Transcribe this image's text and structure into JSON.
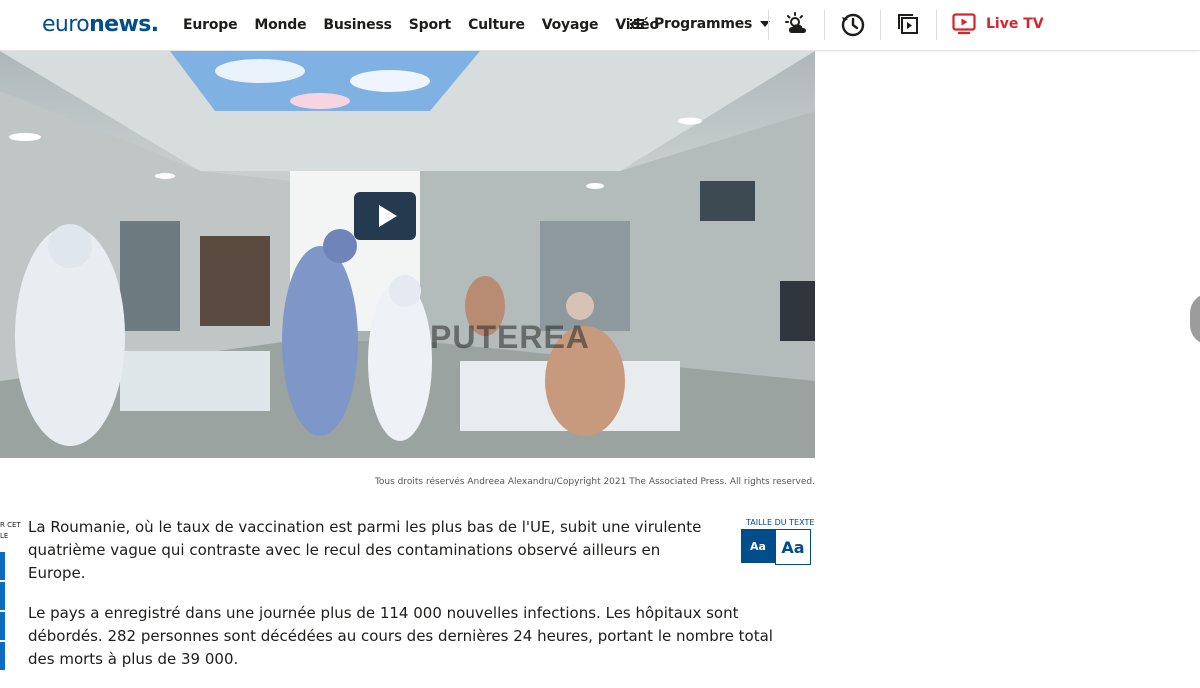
{
  "header": {
    "logo_part1": "euro",
    "logo_part2": "news.",
    "nav": [
      "Europe",
      "Monde",
      "Business",
      "Sport",
      "Culture",
      "Voyage",
      "Vidéo"
    ],
    "programmes_label": "Programmes",
    "live_label": "Live TV",
    "icons": [
      "weather-icon",
      "history-icon",
      "collection-icon",
      "live-tv-icon"
    ]
  },
  "media": {
    "watermark": "PUTEREA",
    "caption": "Tous droits réservés  Andreea Alexandru/Copyright 2021 The Associated Press. All rights reserved."
  },
  "share_rail": {
    "label": "R CET\nLE"
  },
  "text_size": {
    "label": "TAILLE DU TEXTE",
    "small": "Aa",
    "large": "Aa"
  },
  "article": {
    "paragraphs": [
      "La Roumanie, où le taux de vaccination est parmi les plus bas de l'UE, subit une virulente quatrième vague qui contraste avec le recul des contaminations observé ailleurs en Europe.",
      "Le pays a enregistré dans une journée plus de 114 000 nouvelles infections. Les hôpitaux sont débordés. 282 personnes sont décédées au cours des dernières 24 heures, portant le nombre total des morts à plus de 39 000."
    ]
  },
  "colors": {
    "brand": "#004d8c",
    "live_red": "#d9232d",
    "share_blue": "#0d6cc2"
  }
}
